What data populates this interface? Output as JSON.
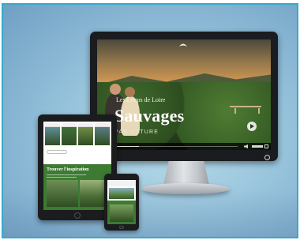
{
  "website": {
    "kicker": "Les Loups de Loire",
    "title": "Sauvages",
    "subtitle": "PAR NATURE",
    "video_progress": 0.22,
    "logo_icon": "leaf-logo-icon",
    "play_icon": "play-icon"
  },
  "tablet_page": {
    "section_heading": "Trouver l'inspiration",
    "thumbnail_colors": [
      "#5f8f98",
      "#3f6f3b",
      "#6f8d45",
      "#5b7d82"
    ]
  },
  "colors": {
    "frame_border": "#38a9c9",
    "brand_green": "#3d7b33"
  }
}
